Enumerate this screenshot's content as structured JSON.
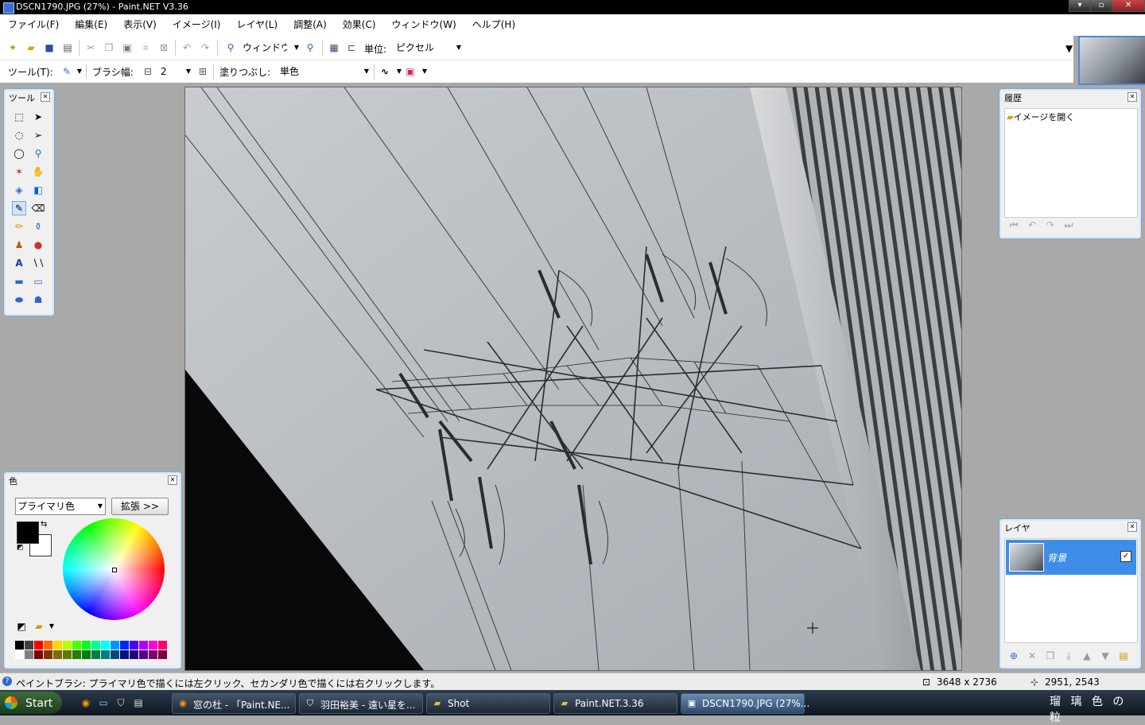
{
  "window": {
    "title": "DSCN1790.JPG (27%) - Paint.NET V3.36"
  },
  "menu": [
    "ファイル(F)",
    "編集(E)",
    "表示(V)",
    "イメージ(I)",
    "レイヤ(L)",
    "調整(A)",
    "効果(C)",
    "ウィンドウ(W)",
    "ヘルプ(H)"
  ],
  "toolbar1": {
    "zoom_value": "ウィンドウ",
    "unit_label": "単位:",
    "unit_value": "ピクセル"
  },
  "toolbar2": {
    "tool_label": "ツール(T):",
    "brush_width_label": "ブラシ幅:",
    "brush_width_value": "2",
    "fill_label": "塗りつぶし:",
    "fill_value": "単色"
  },
  "tools_panel": {
    "title": "ツール"
  },
  "history_panel": {
    "title": "履歴",
    "items": [
      "イメージを開く"
    ]
  },
  "layers_panel": {
    "title": "レイヤ",
    "layers": [
      {
        "name": "背景",
        "visible": true
      }
    ]
  },
  "colors_panel": {
    "title": "色",
    "mode_value": "プライマリ色",
    "expand_label": "拡張 >>",
    "primary_color": "#000000",
    "secondary_color": "#ffffff"
  },
  "status": {
    "hint": "ペイントブラシ: プライマリ色で描くには左クリック、セカンダリ色で描くには右クリックします。",
    "image_size": "3648 x 2736",
    "cursor_pos": "2951, 2543"
  },
  "taskbar": {
    "start_label": "Start",
    "tasks": [
      "窓の杜 - 「Paint.NE...",
      "羽田裕美 - 遠い星を...",
      "Shot",
      "Paint.NET.3.36",
      "DSCN1790.JPG (27%..."
    ],
    "tray_text": "瑠 璃 色 の 粒"
  }
}
